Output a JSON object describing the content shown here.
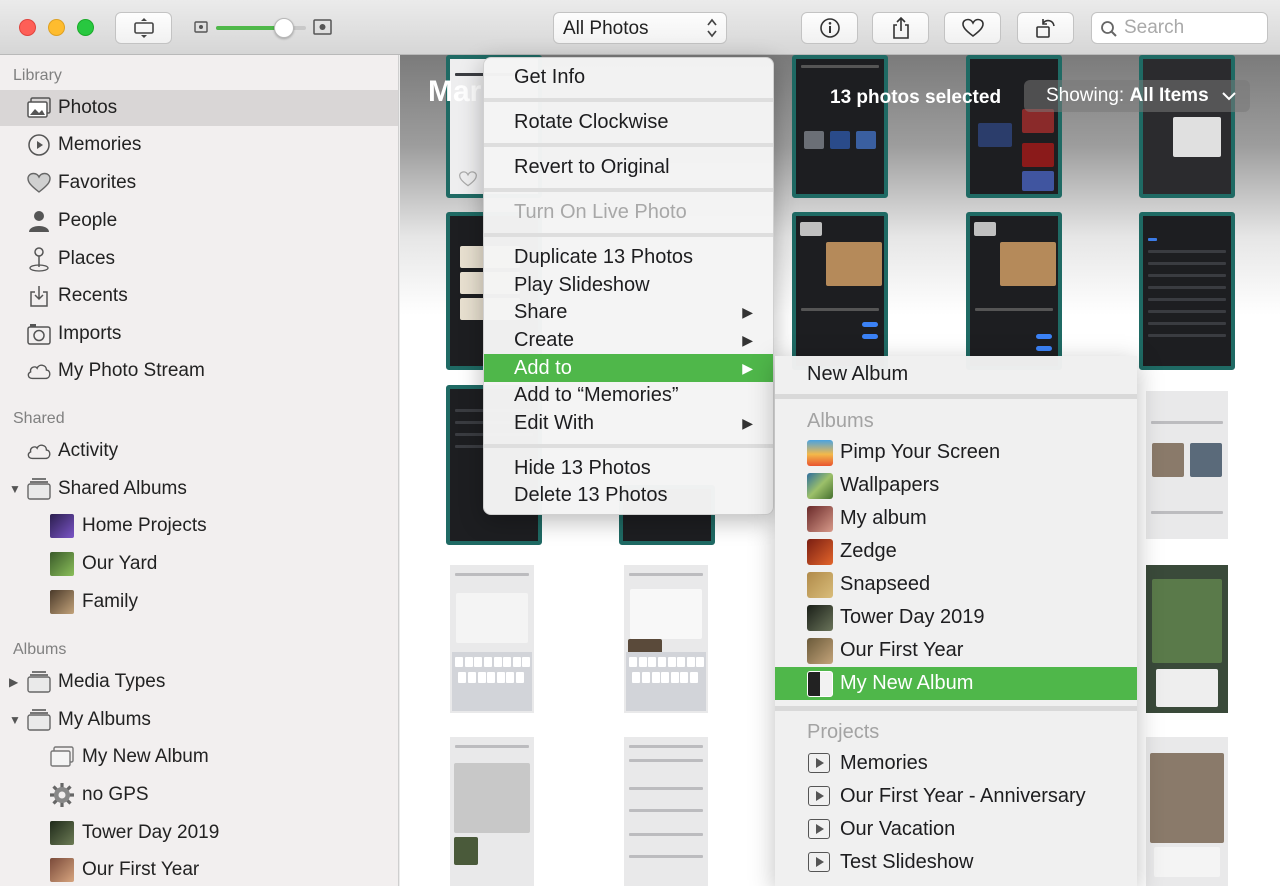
{
  "toolbar": {
    "view_filter": "All Photos",
    "search_placeholder": "Search",
    "zoom_level": 0.75
  },
  "sidebar": {
    "library_header": "Library",
    "library_items": [
      {
        "label": "Photos",
        "icon": "photos-icon",
        "selected": true
      },
      {
        "label": "Memories",
        "icon": "memories-icon"
      },
      {
        "label": "Favorites",
        "icon": "heart-icon"
      },
      {
        "label": "People",
        "icon": "person-icon"
      },
      {
        "label": "Places",
        "icon": "pin-icon"
      },
      {
        "label": "Recents",
        "icon": "recents-icon"
      },
      {
        "label": "Imports",
        "icon": "camera-icon"
      },
      {
        "label": "My Photo Stream",
        "icon": "cloud-icon"
      }
    ],
    "shared_header": "Shared",
    "shared_items": [
      {
        "label": "Activity",
        "icon": "cloud-icon"
      },
      {
        "label": "Shared Albums",
        "icon": "album-stack-icon"
      },
      {
        "label": "Home Projects",
        "icon": "album-thumb-icon"
      },
      {
        "label": "Our Yard",
        "icon": "album-thumb-icon"
      },
      {
        "label": "Family",
        "icon": "album-thumb-icon"
      }
    ],
    "albums_header": "Albums",
    "album_items": [
      {
        "label": "Media Types",
        "icon": "album-stack-icon"
      },
      {
        "label": "My Albums",
        "icon": "album-stack-icon"
      },
      {
        "label": "My New Album",
        "icon": "album-icon"
      },
      {
        "label": "no GPS",
        "icon": "gear-icon"
      },
      {
        "label": "Tower Day 2019",
        "icon": "album-thumb-icon"
      },
      {
        "label": "Our First Year",
        "icon": "album-thumb-icon"
      }
    ]
  },
  "main": {
    "title": "Mar",
    "selection_count": "13 photos selected",
    "showing_label": "Showing:",
    "showing_value": "All Items"
  },
  "context_menu": {
    "items": [
      {
        "label": "Get Info"
      },
      {
        "label": "Rotate Clockwise"
      },
      {
        "label": "Revert to Original"
      },
      {
        "label": "Turn On Live Photo",
        "disabled": true
      },
      {
        "label": "Duplicate 13 Photos"
      },
      {
        "label": "Play Slideshow"
      },
      {
        "label": "Share",
        "submenu": true
      },
      {
        "label": "Create",
        "submenu": true
      },
      {
        "label": "Add to",
        "submenu": true,
        "highlighted": true
      },
      {
        "label": "Add to “Memories”"
      },
      {
        "label": "Edit With",
        "submenu": true
      },
      {
        "label": "Hide 13 Photos"
      },
      {
        "label": "Delete 13 Photos"
      }
    ]
  },
  "submenu": {
    "new_album": "New Album",
    "albums_header": "Albums",
    "albums": [
      {
        "label": "Pimp Your Screen"
      },
      {
        "label": "Wallpapers"
      },
      {
        "label": "My album"
      },
      {
        "label": "Zedge"
      },
      {
        "label": "Snapseed"
      },
      {
        "label": "Tower Day 2019"
      },
      {
        "label": "Our First Year"
      },
      {
        "label": "My New Album",
        "highlighted": true
      }
    ],
    "projects_header": "Projects",
    "projects": [
      {
        "label": "Memories"
      },
      {
        "label": "Our First Year - Anniversary"
      },
      {
        "label": "Our Vacation"
      },
      {
        "label": "Test Slideshow"
      }
    ]
  },
  "colors": {
    "accent_green": "#4fb74a",
    "selection_border": "#1f6a64"
  }
}
